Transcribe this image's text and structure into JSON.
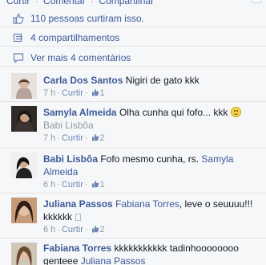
{
  "top_actions": {
    "curtir": "Curtir",
    "comentar": "Comentar",
    "compartilhar": "Compartilhar",
    "separator": "·"
  },
  "summary": {
    "likes": "110 pessoas curtiram isso.",
    "shares": "4 compartilhamentos",
    "more_comments": "Ver mais 4 comentários"
  },
  "ui": {
    "like_label": "Curtir",
    "dot": "·"
  },
  "comments": [
    {
      "author": "Carla Dos Santos",
      "text": "Nigiri de gato kkk",
      "time": "7 h",
      "likes": "1",
      "mention": "",
      "text_after": ""
    },
    {
      "author": "Samyla Almeida",
      "text": "Olha cunha qui fofo... kkk",
      "mention": "Babi Lisbôa",
      "time": "7 h",
      "likes": "2",
      "text_after": ""
    },
    {
      "author": "Babi Lisbôa",
      "text": "Fofo mesmo cunha, rs.",
      "mention": "Samyla Almeida",
      "time": "6 h",
      "likes": "1",
      "text_after": ""
    },
    {
      "author": "Juliana Passos",
      "text": "",
      "mention": "Fabiana Torres",
      "text_after": ", leve o seuuuu!!! kkkkkk",
      "time": "6 h",
      "likes": "2"
    },
    {
      "author": "Fabiana Torres",
      "text": "kkkkkkkkkkk tadinhoooooooo genteee",
      "mention": "Juliana Passos",
      "time": "",
      "likes": "",
      "text_after": ""
    }
  ],
  "colors": {
    "link": "#3b5998",
    "meta": "#9197a3",
    "background": "#f6f7f9",
    "divider": "#e1e2e3"
  },
  "icons": [
    "like-thumb-icon",
    "share-icon",
    "comment-bubble-icon",
    "smiley-emoticon",
    "like-count-thumb-icon"
  ]
}
